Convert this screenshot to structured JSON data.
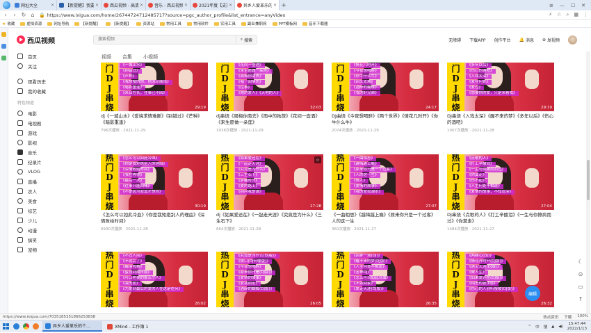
{
  "browser": {
    "tabs": [
      {
        "label": "网址大全",
        "fav": "blue"
      },
      {
        "label": "【新提醒】我要翻…",
        "fav": "dark"
      },
      {
        "label": "西瓜视频 - 高清免费在…",
        "fav": "red"
      },
      {
        "label": "音乐 - 西瓜视频",
        "fav": "red"
      },
      {
        "label": "2021年度【支持中…",
        "fav": "red"
      },
      {
        "label": "异乡人爱革乐的个人主…",
        "fav": "red"
      }
    ],
    "active_tab_index": 5,
    "url": "https://www.ixigua.com/home/26744724712485717?source=pgc_author_profile&list_entrance=anyVideo",
    "bookmarks": [
      "收藏",
      "虚拟资源",
      "网址导航",
      "【新提醒】",
      "【新提醒】",
      "资源站",
      "常用工具",
      "常用软件",
      "实用工具",
      "副业兼职网",
      "PPT模板网",
      "音乐下载器"
    ],
    "status_url": "https://www.ixigua.com/7035185351866253838",
    "status_right": [
      "热点资讯",
      "下载",
      "100%"
    ]
  },
  "site": {
    "logo_text": "西瓜视频",
    "search_placeholder": "搜索视频",
    "search_button": "搜索",
    "header_links": [
      "无障碍",
      "下载APP",
      "创作平台",
      "消息",
      "发视频"
    ],
    "nav_top": [
      "首页",
      "关注"
    ],
    "nav_mid": [
      "观看历史",
      "我的收藏"
    ],
    "nav_section_title": "特色频道",
    "nav_channels": [
      "电影",
      "电视剧",
      "游戏",
      "影视",
      "音乐",
      "纪录片",
      "VLOG",
      "直播",
      "农人",
      "美食",
      "综艺",
      "少儿",
      "动漫",
      "搞笑",
      "宠物"
    ],
    "main_tabs": [
      "视频",
      "合集",
      "小视频"
    ]
  },
  "banner_chars": [
    "热",
    "门",
    "D",
    "J",
    "串",
    "烧"
  ],
  "videos": [
    {
      "title": "dj《一城山水》《爱境求情难断》《别错过》《芒种》《暗影重逢》",
      "meta": "796次播放 · 2021-11-29",
      "duration": "29:19",
      "lyrics": [
        "《爱境求情难断》",
        "《一城山水》",
        "《别错过》",
        "《芒种》",
        "《我想慢的你，你冰凉戚雨》",
        "《暗影重逢》",
        "《来日方长，往事已不回》"
      ],
      "fav": false
    },
    {
      "title": "dj串烧《周梅你南去》《雨中的祐旅》《花间一壶酒》《来生愿做一朵莲》",
      "meta": "1038次播放 · 2021-11-29",
      "duration": "32:03",
      "lyrics": [
        "《雨中的祐旅》",
        "《花间一壶酒》",
        "《来生愿做一朵莲》",
        "《周梅你南去》",
        "《唱一回情伤》",
        "《往事》",
        "《她的爱人》《天地的人》"
      ],
      "fav": false
    },
    {
      "title": "DJ曲烧《今夜想喝醉》《两个世界》《情花几时开》《你牛什么牛》",
      "meta": "2074次播放 · 2021-11-29",
      "duration": "24:17",
      "lyrics": [
        "《两个世界》",
        "《情花几时开》",
        "《今夜想喝醉》",
        "《你牛什么牛》",
        "《回头太难》",
        "《酒醉的蝴蝶》",
        "《我的好兄弟》"
      ],
      "fav": false
    },
    {
      "title": "DJ串烧《入戏太深》《醒不来的梦》《多年以后》《伤心的酒吧》",
      "meta": "1007次播放 · 2021-11-28",
      "duration": "29:19",
      "lyrics": [
        "《醒不来的梦》",
        "《多年以后》",
        "《伤心的酒吧》",
        "《入戏太深》",
        "《爱在何处》",
        "《爱过》",
        "《想要你的爱，只是来看我》"
      ],
      "fav": false
    },
    {
      "title": "《怎么可以如此冷血》《你是我矩绝别人的理由》《深情败给时间》",
      "meta": "6930次播放 · 2021-11-28",
      "duration": "30:19",
      "lyrics": [
        "《怎么可以如此冷血》",
        "《你是我矩绝别人的理由》",
        "《深情败给时间》",
        "《我在等你》",
        "《最后一次》",
        "《往事只能回味》",
        "《不是因为寂寞才想你》"
      ],
      "fav": false
    },
    {
      "title": "dj《如果爱还在》《一起走天涯》《究竟是为什么》《三生石下》",
      "meta": "664次播放 · 2021-11-28",
      "duration": "27:28",
      "lyrics": [
        "《如果爱还在》",
        "《一起走天涯》",
        "《究竟是为什么》",
        "《三生石下》",
        "《梦醒时分》",
        "《爱的路上》",
        "《别问我是谁》"
      ],
      "fav": true
    },
    {
      "title": "《一曲相思》《越嗨越上瘾》《原来你只是一个过客》人的这一生",
      "meta": "360次播放 · 2021-11-27",
      "duration": "27:07",
      "lyrics": [
        "《一曲相思》",
        "《越嗨越上瘾》",
        "《原来你只是一个过客》",
        "《人的这一生》",
        "《情人》",
        "《爱情的故事》",
        "《我的爱如潮水》"
      ],
      "fav": false
    },
    {
      "title": "DJ串烧《点歌的人》《打工辛酸泪》《一生与你擦肩而过》《你莫走》",
      "meta": "1484次播放 · 2021-11-27",
      "duration": "27:04",
      "lyrics": [
        "《点歌的人》",
        "《打工辛酸泪》",
        "《一生与你擦肩而过》",
        "《你莫走》",
        "《伤不起》",
        "《人生何处不相逢》",
        "《爱情的故事，不知道深》"
      ],
      "fav": false
    },
    {
      "title": "",
      "meta": "",
      "duration": "26:02",
      "lyrics": [
        "《不过人间》",
        "《不就完了》",
        "《撮落包赛》",
        "《蜜饯到期日期》",
        "《可口老婆的那么个人》",
        "《我的爱》",
        "《为爱到最后的爱的人在这是在何》"
      ],
      "fav": false
    },
    {
      "title": "",
      "meta": "",
      "duration": "26:05",
      "lyrics": [
        "《究竟是为什么(DJ版)》",
        "《傻口(DJ何哪版)》",
        "《今夜想喝醉》",
        "《原来你只是(DJ版)》",
        "《爱情的故事》",
        "《爱我别走》",
        "《酒醉的蝴蝶(DJ版)》"
      ],
      "fav": false
    },
    {
      "title": "",
      "meta": "",
      "duration": "26:35",
      "lyrics": [
        "《回梦一场(DJ)》",
        "《醒不来的梦(DJ版)》",
        "《人生何处不相逢》",
        "《苦神DJ》",
        "《怎么可以如此冷血》",
        "《不如回家》",
        "《爱走天涯(DJ版)》"
      ],
      "fav": false
    },
    {
      "title": "",
      "meta": "",
      "duration": "26:32",
      "lyrics": [
        "《两颗心(DJ)》",
        "《情花开时开(DJ版)》",
        "《遇见天涯(DJ版)》",
        "《做人生》",
        "《如果爱还在(DJ版)》",
        "《相思的夜(DJ)》",
        "《伤心的人别听慢歌(DJ版)》"
      ],
      "fav": false
    }
  ],
  "float_tools": [
    "☾",
    "⊙",
    "▭",
    "↑"
  ],
  "edit_bubble": "编辑",
  "taskbar": {
    "tasks": [
      {
        "label": "异乡人爱革乐的个…",
        "active": true
      },
      {
        "label": "XMind - 工作簿 1",
        "active": false
      }
    ],
    "tray": [
      "^",
      "中",
      "搜"
    ],
    "time": "15:47:44",
    "date": "2022/1/13"
  }
}
